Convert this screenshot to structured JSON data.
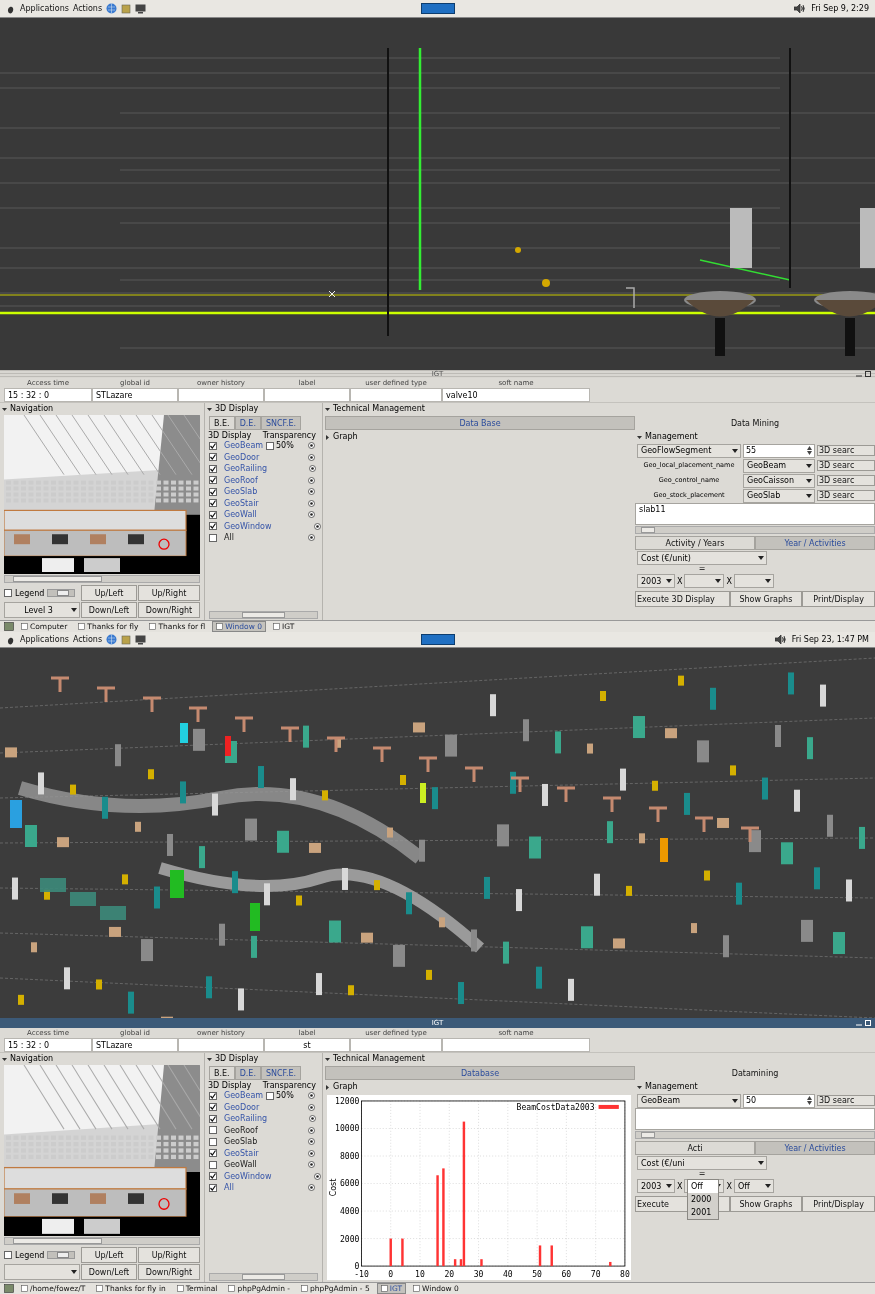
{
  "screens": [
    {
      "top_panel": {
        "menus": [
          "Applications",
          "Actions"
        ],
        "clock": "Fri Sep  9,  2:29"
      },
      "viewport": {
        "kind": "plumbing"
      },
      "window": {
        "title": "IGT",
        "active": false,
        "fields": [
          {
            "label": "Access time",
            "value": "15 : 32 : 0"
          },
          {
            "label": "global id",
            "value": "STLazare"
          },
          {
            "label": "owner history"
          },
          {
            "label": "label"
          },
          {
            "label": "user defined type"
          },
          {
            "label": "soft name",
            "value": "valve10"
          }
        ],
        "navigation": {
          "title": "Navigation",
          "legend": {
            "label": "Legend",
            "checked": false,
            "level": 0.55
          },
          "buttons": [
            "Up/Left",
            "Up/Right",
            "Down/Left",
            "Down/Right"
          ],
          "level_select": "Level 3"
        },
        "display": {
          "title": "3D Display",
          "tabs": [
            {
              "label": "B.E.",
              "selected": true
            },
            {
              "label": "D.E.",
              "selected": false
            },
            {
              "label": "SNCF.E.",
              "selected": false
            }
          ],
          "column_1": "3D Display",
          "column_2": "Transparency",
          "transparency": {
            "label": "50%",
            "checked": false
          },
          "layers": [
            {
              "label": "GeoBeam",
              "checked": true
            },
            {
              "label": "GeoDoor",
              "checked": true
            },
            {
              "label": "GeoRailing",
              "checked": true
            },
            {
              "label": "GeoRoof",
              "checked": true
            },
            {
              "label": "GeoSlab",
              "checked": true
            },
            {
              "label": "GeoStair",
              "checked": true
            },
            {
              "label": "GeoWall",
              "checked": true
            },
            {
              "label": "GeoWindow",
              "checked": true
            },
            {
              "label": "All",
              "checked": false
            }
          ]
        },
        "technical": {
          "title": "Technical Management",
          "tabs": [
            {
              "label": "Data Base",
              "selected": false
            },
            {
              "label": "Data Mining",
              "selected": true
            }
          ],
          "graph_title": "Graph",
          "mining": {
            "title": "Management",
            "query": {
              "type": "GeoFlowSegment",
              "count": "55",
              "button": "3D searc"
            },
            "rows": [
              {
                "label": "Geo_local_placement_name",
                "value": "GeoBeam",
                "button": "3D searc"
              },
              {
                "label": "Geo_control_name",
                "value": "GeoCaisson",
                "button": "3D searc"
              },
              {
                "label": "Geo_stock_placement",
                "value": "GeoSlab",
                "button": "3D searc"
              }
            ],
            "result": "slab11",
            "tabs": [
              {
                "label": "Activity / Years",
                "selected": true
              },
              {
                "label": "Year / Activities",
                "selected": false
              }
            ],
            "measure": "Cost (€/unit)",
            "equals": "=",
            "year": "2003",
            "slots": [
              {
                "operator": "X",
                "open": false
              },
              {
                "operator": "X",
                "open": false
              }
            ],
            "buttons": [
              "Execute 3D Display",
              "Show Graphs",
              "Print/Display"
            ]
          }
        }
      },
      "taskbar": [
        {
          "label": "Computer",
          "selected": false
        },
        {
          "label": "Thanks for fly",
          "selected": false
        },
        {
          "label": "Thanks for fl",
          "selected": false
        },
        {
          "label": "Window 0",
          "selected": true
        },
        {
          "label": "IGT",
          "selected": false
        }
      ]
    },
    {
      "top_panel": {
        "menus": [
          "Applications",
          "Actions"
        ],
        "clock": "Fri Sep 23,  1:47 PM"
      },
      "viewport": {
        "kind": "network"
      },
      "window": {
        "title": "IGT",
        "active": true,
        "fields": [
          {
            "label": "Access time",
            "value": "15 : 32 : 0"
          },
          {
            "label": "global id",
            "value": "STLazare"
          },
          {
            "label": "owner history"
          },
          {
            "label": "label",
            "value": "st"
          },
          {
            "label": "user defined type"
          },
          {
            "label": "soft name"
          }
        ],
        "navigation": {
          "title": "Navigation",
          "legend": {
            "label": "Legend",
            "checked": false,
            "level": 0.55
          },
          "buttons": [
            "Up/Left",
            "Up/Right",
            "Down/Left",
            "Down/Right"
          ]
        },
        "display": {
          "title": "3D Display",
          "tabs": [
            {
              "label": "B.E.",
              "selected": true
            },
            {
              "label": "D.E.",
              "selected": false
            },
            {
              "label": "SNCF.E.",
              "selected": false
            }
          ],
          "column_1": "3D Display",
          "column_2": "Transparency",
          "transparency": {
            "label": "50%",
            "checked": false
          },
          "layers": [
            {
              "label": "GeoBeam",
              "checked": true
            },
            {
              "label": "GeoDoor",
              "checked": true
            },
            {
              "label": "GeoRailing",
              "checked": true
            },
            {
              "label": "GeoRoof",
              "checked": false
            },
            {
              "label": "GeoSlab",
              "checked": false
            },
            {
              "label": "GeoStair",
              "checked": true
            },
            {
              "label": "GeoWall",
              "checked": false
            },
            {
              "label": "GeoWindow",
              "checked": true
            },
            {
              "label": "All",
              "checked": true
            }
          ]
        },
        "technical": {
          "title": "Technical Management",
          "tabs": [
            {
              "label": "Database",
              "selected": false
            },
            {
              "label": "Datamining",
              "selected": true
            }
          ],
          "graph_title": "Graph",
          "chart_data": {
            "type": "bar",
            "ylabel": "Cost",
            "series": [
              {
                "name": "BeamCostData2003",
                "color": "#ff3333",
                "values": [
                  2000,
                  2000,
                  6600,
                  7100,
                  500,
                  500,
                  10500,
                  500,
                  1500,
                  1500,
                  300
                ]
              }
            ],
            "x": [
              0,
              4,
              16,
              18,
              22,
              24,
              25,
              31,
              51,
              55,
              75
            ],
            "grid": true,
            "xlim": [
              -10,
              80
            ],
            "ylim": [
              0,
              12000
            ],
            "xticks": [
              -10,
              0,
              10,
              20,
              30,
              40,
              50,
              60,
              70,
              80
            ],
            "yticks": [
              0,
              2000,
              4000,
              6000,
              8000,
              10000,
              12000
            ]
          },
          "mining": {
            "title": "Management",
            "query": {
              "type": "GeoBeam",
              "count": "50",
              "button": "3D searc"
            },
            "tabs": [
              {
                "label": "Acti",
                "selected": true
              },
              {
                "label": "Year / Activities",
                "selected": false
              }
            ],
            "measure": "Cost (€/uni",
            "equals": "=",
            "year": "2003",
            "slots": [
              {
                "operator": "X",
                "open": true,
                "options": [
                  {
                    "label": "Off",
                    "selected": true
                  },
                  {
                    "label": "2000",
                    "selected": false
                  },
                  {
                    "label": "2001",
                    "selected": false
                  }
                ]
              },
              {
                "operator": "X",
                "value": "Off",
                "open": false
              }
            ],
            "buttons": [
              "Execute",
              "Show Graphs",
              "Print/Display"
            ]
          }
        }
      },
      "taskbar": [
        {
          "label": "/home/fowez/T",
          "selected": false
        },
        {
          "label": "Thanks for fly in",
          "selected": false
        },
        {
          "label": "Terminal",
          "selected": false
        },
        {
          "label": "phpPgAdmin -",
          "selected": false
        },
        {
          "label": "phpPgAdmin - 5",
          "selected": false
        },
        {
          "label": "IGT",
          "selected": true
        },
        {
          "label": "Window 0",
          "selected": false
        }
      ]
    }
  ]
}
